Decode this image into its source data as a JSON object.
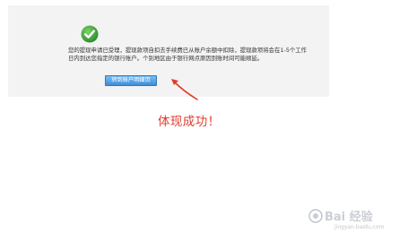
{
  "success": {
    "icon": "check-circle-icon",
    "message": "您的提现申请已受理，提现款项自扣去手续费已从账户余额中扣除，提现款项将会在1-5个工作日内到达您指定的银行账户。个别地区由于银行网点原因到账时间可能顺延。",
    "button_label": "转到账户明细页"
  },
  "annotation": {
    "text": "体现成功！",
    "arrow_icon": "red-arrow-icon"
  },
  "watermark": {
    "brand": "Bai 经验",
    "url": "jingyan.baidu.com"
  },
  "colors": {
    "panel_bg": "#f3f3f3",
    "button": "#4a98dc",
    "check": "#3ea640",
    "annotation": "#e03c2c"
  }
}
